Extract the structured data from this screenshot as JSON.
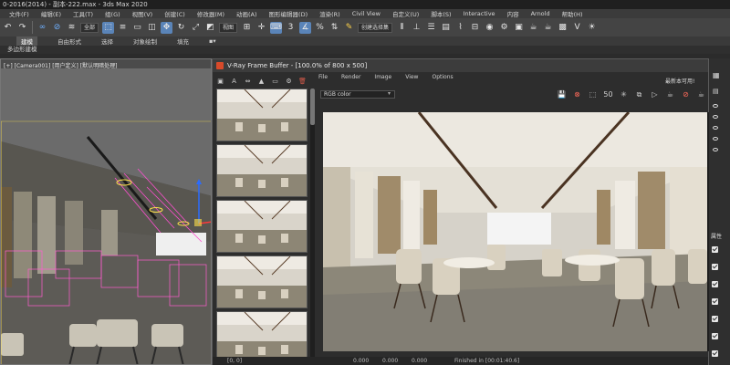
{
  "window": {
    "title": "0-2016(2014) - 副本-222.max - 3ds Max 2020"
  },
  "menubar": {
    "items": [
      "文件(F)",
      "编辑(E)",
      "工具(T)",
      "组(G)",
      "视图(V)",
      "创建(C)",
      "修改器(M)",
      "动画(A)",
      "图形编辑器(D)",
      "渲染(R)",
      "Civil View",
      "自定义(U)",
      "脚本(S)",
      "Interactive",
      "内容",
      "Arnold",
      "帮助(H)"
    ]
  },
  "toolbar": {
    "selection_set_label": "全部",
    "reference_coord_label": "视图",
    "named_selection_label": "创建选择集"
  },
  "ribbon": {
    "tabs": [
      "建模",
      "自由形式",
      "选择",
      "对象绘制",
      "填充"
    ],
    "sub_label": "多边形建模"
  },
  "viewport": {
    "label": "[+] [Camera001] [用户定义] [默认明暗处理]"
  },
  "vfb": {
    "title": "V-Ray Frame Buffer - [100.0% of 800 x 500]",
    "menu": [
      "File",
      "Render",
      "Image",
      "View",
      "Options"
    ],
    "channel": "RGB color",
    "status_coords": "[0, 0]",
    "status_value1": "0.000",
    "status_value2": "0.000",
    "status_value3": "0.000",
    "status_finished": "Finished in [00:01:40.6]",
    "update_notice": "最新本可用!"
  },
  "command_panel": {
    "properties_label": "属性"
  },
  "icons": {
    "undo": "undo-icon",
    "redo": "redo-icon",
    "link": "link-icon",
    "unlink": "unlink-icon",
    "select": "select-icon",
    "move": "move-icon",
    "rotate": "rotate-icon",
    "scale": "scale-icon",
    "snap": "snap-icon",
    "render": "render-teapot-icon",
    "save": "save-icon",
    "trash": "trash-icon"
  },
  "colors": {
    "accent": "#5a84b8",
    "vray_red": "#d84a2a",
    "render_floor": "#8a8578",
    "render_ceiling": "#ece8e0"
  }
}
